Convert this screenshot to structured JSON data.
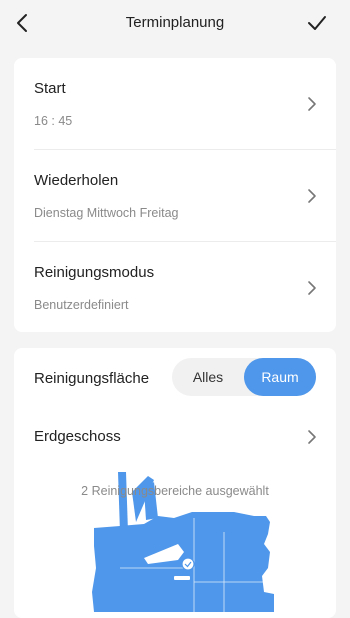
{
  "header": {
    "title": "Terminplanung",
    "back_icon": "chevron-left-icon",
    "confirm_icon": "checkmark-icon"
  },
  "schedule": {
    "start": {
      "label": "Start",
      "value": "16 : 45"
    },
    "repeat": {
      "label": "Wiederholen",
      "value": "Dienstag Mittwoch Freitag"
    },
    "mode": {
      "label": "Reinigungsmodus",
      "value": "Benutzerdefiniert"
    }
  },
  "area": {
    "label": "Reinigungsfläche",
    "options": [
      "Alles",
      "Raum"
    ],
    "selected": "Raum"
  },
  "floor": {
    "label": "Erdgeschoss"
  },
  "map": {
    "selection_text": "2 Reinigungsbereiche ausgewählt"
  },
  "colors": {
    "accent": "#4f97ea",
    "background": "#f4f4f4",
    "card": "#ffffff"
  }
}
